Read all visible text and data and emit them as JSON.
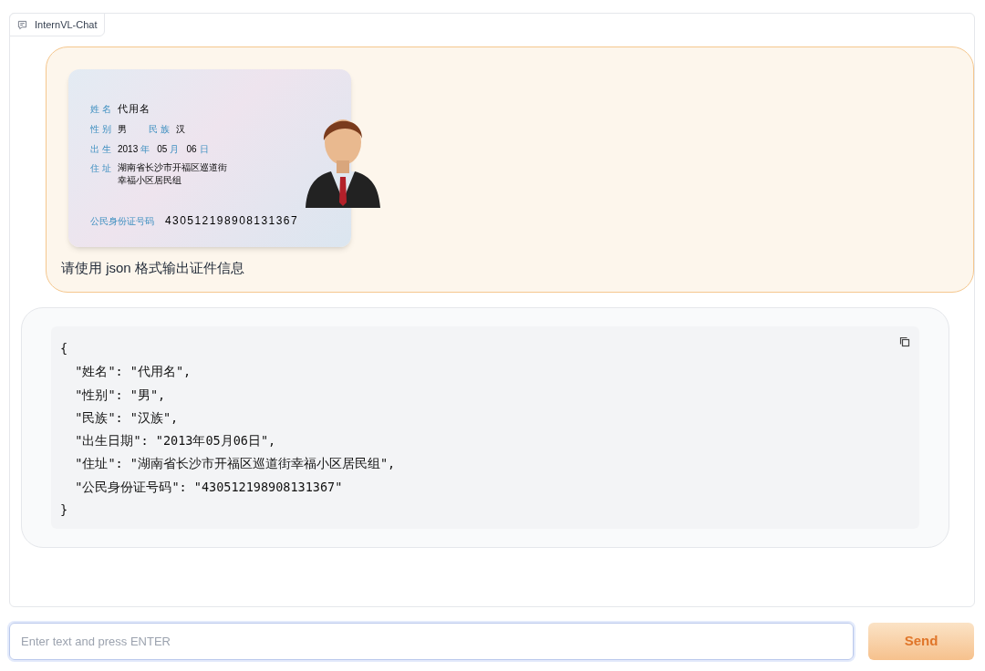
{
  "panel": {
    "label": "InternVL-Chat"
  },
  "user_message": {
    "id_card": {
      "name_label": "姓名",
      "name": "代用名",
      "sex_label": "性别",
      "sex": "男",
      "ethnicity_label": "民族",
      "ethnicity": "汉",
      "birth_label": "出生",
      "birth": [
        {
          "value": "2013",
          "unit": "年"
        },
        {
          "value": "05",
          "unit": "月"
        },
        {
          "value": "06",
          "unit": "日"
        }
      ],
      "address_label": "住址",
      "address_lines": [
        "湖南省长沙市开福区巡道街",
        "幸福小区居民组"
      ],
      "id_label": "公民身份证号码",
      "id_number": "430512198908131367"
    },
    "text": "请使用 json 格式输出证件信息"
  },
  "bot_message": {
    "code_lines": [
      "{",
      "  \"姓名\": \"代用名\",",
      "  \"性别\": \"男\",",
      "  \"民族\": \"汉族\",",
      "  \"出生日期\": \"2013年05月06日\",",
      "  \"住址\": \"湖南省长沙市开福区巡道街幸福小区居民组\",",
      "  \"公民身份证号码\": \"430512198908131367\"",
      "}"
    ]
  },
  "input": {
    "placeholder": "Enter text and press ENTER"
  },
  "send_button": {
    "label": "Send"
  }
}
